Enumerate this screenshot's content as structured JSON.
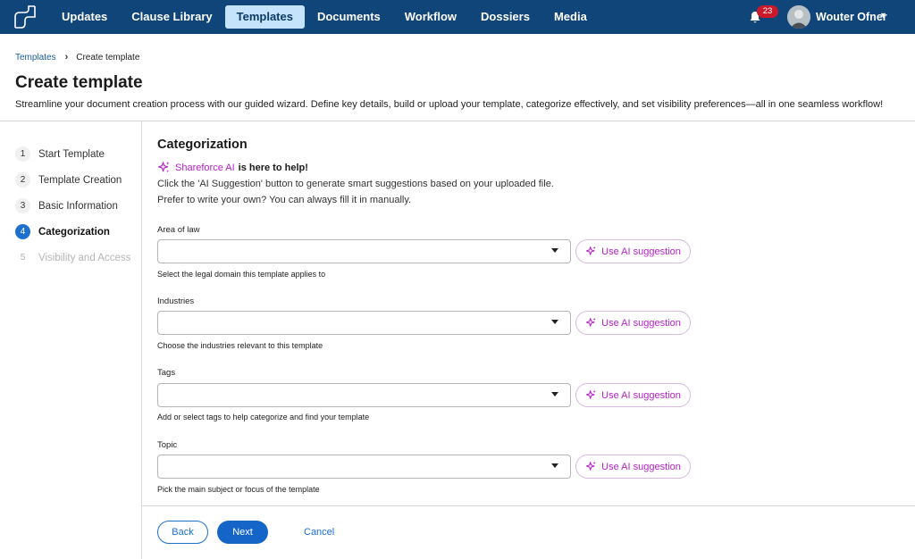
{
  "header": {
    "nav": [
      {
        "label": "Updates",
        "active": false
      },
      {
        "label": "Clause Library",
        "active": false
      },
      {
        "label": "Templates",
        "active": true
      },
      {
        "label": "Documents",
        "active": false
      },
      {
        "label": "Workflow",
        "active": false
      },
      {
        "label": "Dossiers",
        "active": false
      },
      {
        "label": "Media",
        "active": false
      }
    ],
    "notification_count": "23",
    "user_name": "Wouter Ofner",
    "colors": {
      "bar": "#10457a",
      "active_tab": "#c5e3fb",
      "badge": "#c91a2c"
    }
  },
  "breadcrumb": {
    "parent": "Templates",
    "current": "Create template"
  },
  "page": {
    "title": "Create template",
    "description": "Streamline your document creation process with our guided wizard. Define key details, build or upload your template, categorize effectively, and set visibility preferences—all in one seamless workflow!"
  },
  "steps": [
    {
      "num": "1",
      "label": "Start Template",
      "state": "done"
    },
    {
      "num": "2",
      "label": "Template Creation",
      "state": "done"
    },
    {
      "num": "3",
      "label": "Basic Information",
      "state": "done"
    },
    {
      "num": "4",
      "label": "Categorization",
      "state": "active"
    },
    {
      "num": "5",
      "label": "Visibility and Access",
      "state": "disabled"
    }
  ],
  "section": {
    "title": "Categorization",
    "ai_brand": "Shareforce AI",
    "ai_help": "is here to help!",
    "ai_text1": "Click the 'AI Suggestion' button to generate smart suggestions based on your uploaded file.",
    "ai_text2": "Prefer to write your own? You can always fill it in manually."
  },
  "fields": [
    {
      "label": "Area of law",
      "value": "",
      "helper": "Select the legal domain this template applies to",
      "ai_button": "Use AI suggestion"
    },
    {
      "label": "Industries",
      "value": "",
      "helper": "Choose the industries relevant to this template",
      "ai_button": "Use AI suggestion"
    },
    {
      "label": "Tags",
      "value": "",
      "helper": "Add or select tags to help categorize and find your template",
      "ai_button": "Use AI suggestion"
    },
    {
      "label": "Topic",
      "value": "",
      "helper": "Pick the main subject or focus of the template",
      "ai_button": "Use AI suggestion"
    }
  ],
  "footer": {
    "back": "Back",
    "next": "Next",
    "cancel": "Cancel"
  },
  "colors": {
    "primary": "#1565c8",
    "ai_accent": "#b521c7"
  }
}
